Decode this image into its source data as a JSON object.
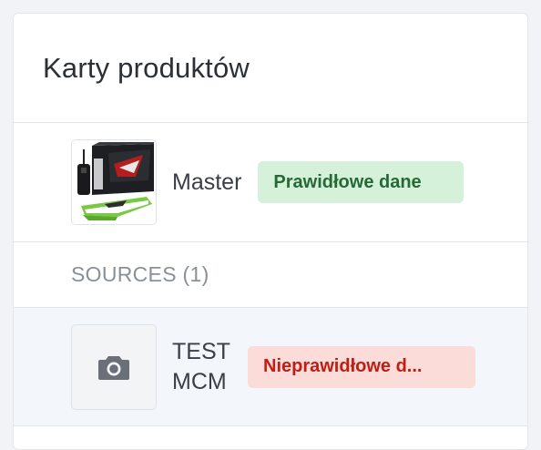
{
  "panel": {
    "title": "Karty produktów"
  },
  "master": {
    "name": "Master",
    "thumbnail_icon": "rc-boat-product-photo",
    "status_label": "Prawidłowe dane",
    "status_color": "#d5f1d9"
  },
  "sources": {
    "section_label": "SOURCES (1)",
    "items": [
      {
        "name": "TEST MCM",
        "thumbnail_icon": "camera-icon",
        "status_label": "Nieprawidłowe d...",
        "status_color": "#fbdcd8"
      }
    ]
  }
}
